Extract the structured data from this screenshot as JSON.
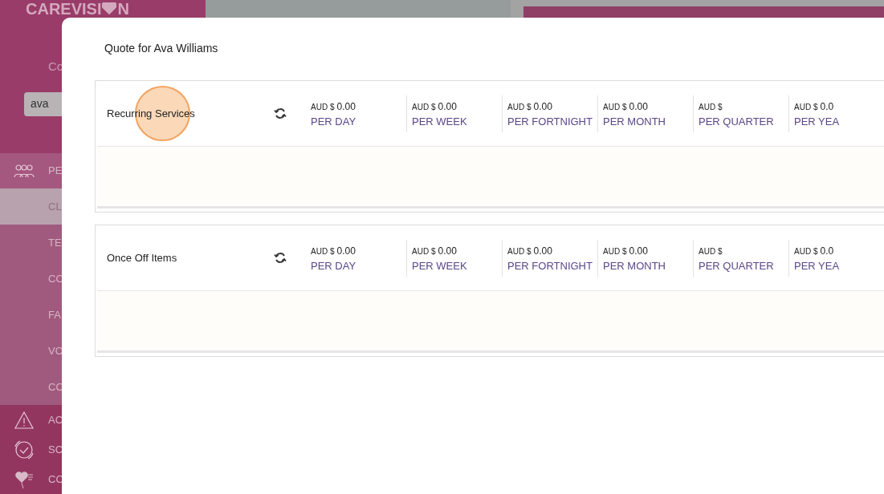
{
  "sidebar": {
    "logo": "CAREVISI",
    "logo_end": "N",
    "heading": "Co",
    "search": {
      "value": "ava"
    },
    "items": [
      {
        "kind": "group",
        "label": "PE",
        "selected": false
      },
      {
        "kind": "sub",
        "label": "CL",
        "selected": true
      },
      {
        "kind": "sub",
        "label": "TE",
        "selected": false
      },
      {
        "kind": "sub",
        "label": "CO",
        "selected": false
      },
      {
        "kind": "sub",
        "label": "FA",
        "selected": false
      },
      {
        "kind": "sub",
        "label": "VO",
        "selected": false
      },
      {
        "kind": "sub",
        "label": "CO",
        "selected": false
      },
      {
        "kind": "bottom",
        "label": "AC",
        "selected": false
      },
      {
        "kind": "bottom",
        "label": "SC",
        "selected": false
      },
      {
        "kind": "bottom",
        "label": "CO",
        "selected": false
      }
    ]
  },
  "modal": {
    "title": "Quote for Ava Williams",
    "sections": [
      {
        "title": "Recurring Services",
        "totals": [
          {
            "currency": "AUD $",
            "amount": "0.00",
            "period": "PER DAY"
          },
          {
            "currency": "AUD $",
            "amount": "0.00",
            "period": "PER WEEK"
          },
          {
            "currency": "AUD $",
            "amount": "0.00",
            "period": "PER FORTNIGHT"
          },
          {
            "currency": "AUD $",
            "amount": "0.00",
            "period": "PER MONTH"
          },
          {
            "currency": "AUD $",
            "period": "PER QUARTER"
          },
          {
            "currency": "AUD $",
            "amount": "0.0",
            "period": "PER YEA"
          }
        ]
      },
      {
        "title": "Once Off Items",
        "totals": [
          {
            "currency": "AUD $",
            "amount": "0.00",
            "period": "PER DAY"
          },
          {
            "currency": "AUD $",
            "amount": "0.00",
            "period": "PER WEEK"
          },
          {
            "currency": "AUD $",
            "amount": "0.00",
            "period": "PER FORTNIGHT"
          },
          {
            "currency": "AUD $",
            "amount": "0.00",
            "period": "PER MONTH"
          },
          {
            "currency": "AUD $",
            "period": "PER QUARTER"
          },
          {
            "currency": "AUD $",
            "amount": "0.0",
            "period": "PER YEA"
          }
        ]
      }
    ]
  }
}
